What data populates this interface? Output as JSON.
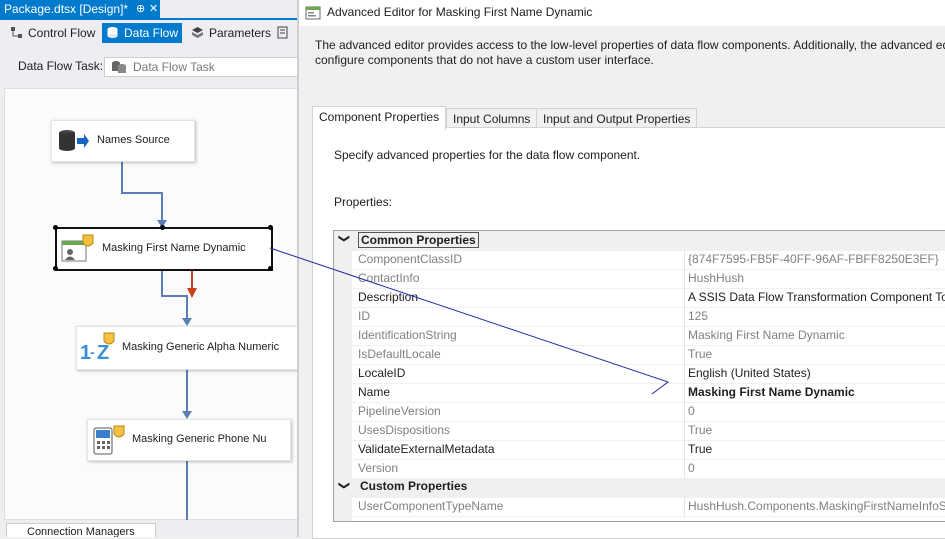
{
  "designer": {
    "doc_tab": {
      "title": "Package.dtsx [Design]*",
      "pin": "⊕",
      "close": "✕"
    },
    "tabs": [
      {
        "label": "Control Flow"
      },
      {
        "label": "Data Flow"
      },
      {
        "label": "Parameters"
      }
    ],
    "task_label": "Data Flow Task:",
    "task_value": "Data Flow Task",
    "nodes": {
      "source": "Names Source",
      "masking_first_name": "Masking First Name Dynamic",
      "alpha_numeric": "Masking Generic Alpha Numeric",
      "phone": "Masking Generic Phone Nu"
    },
    "connection_managers_tab": "Connection Managers"
  },
  "dialog": {
    "title": "Advanced Editor for Masking First Name Dynamic",
    "description_line1": "The advanced editor provides access to the low-level properties of data flow components. Additionally, the advanced editor",
    "description_line2": "configure components that do not have a custom user interface.",
    "tabs": [
      {
        "label": "Component Properties"
      },
      {
        "label": "Input Columns"
      },
      {
        "label": "Input and Output Properties"
      }
    ],
    "panel_text": "Specify advanced properties for the data flow component.",
    "properties_label": "Properties:",
    "grid": {
      "common_category": "Common Properties",
      "rows": [
        {
          "name": "ComponentClassID",
          "value": "{874F7595-FB5F-40FF-96AF-FBFF8250E3EF}"
        },
        {
          "name": "ContactInfo",
          "value": "HushHush"
        },
        {
          "name": "Description",
          "value": "A SSIS Data Flow Transformation Component To"
        },
        {
          "name": "ID",
          "value": "125"
        },
        {
          "name": "IdentificationString",
          "value": "Masking First Name Dynamic"
        },
        {
          "name": "IsDefaultLocale",
          "value": "True"
        },
        {
          "name": "LocaleID",
          "value": "English (United States)"
        },
        {
          "name": "Name",
          "value": "Masking First Name Dynamic"
        },
        {
          "name": "PipelineVersion",
          "value": "0"
        },
        {
          "name": "UsesDispositions",
          "value": "True"
        },
        {
          "name": "ValidateExternalMetadata",
          "value": "True"
        },
        {
          "name": "Version",
          "value": "0"
        }
      ],
      "custom_category": "Custom Properties",
      "custom_rows": [
        {
          "name": "UserComponentTypeName",
          "value": "HushHush.Components.MaskingFirstNameInfoS"
        }
      ]
    }
  },
  "colors": {
    "accent": "#007acc",
    "connector": "#5b7fb5",
    "error_arrow": "#c8401c",
    "annotation_line": "#1a2a9c"
  }
}
